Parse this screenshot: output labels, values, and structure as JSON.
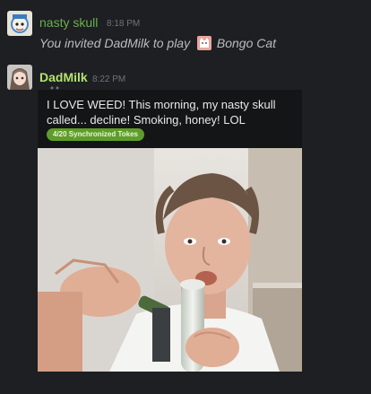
{
  "messages": [
    {
      "author": "nasty skull",
      "author_color": "#6ab04c",
      "time": "8:18 PM",
      "avatar_icon": "cartoon-character-avatar",
      "invite_text": "You invited DadMilk to play",
      "game_icon": "bongo-cat-game-icon",
      "game_name": "Bongo Cat"
    },
    {
      "author": "DadMilk",
      "author_color": "#b4e36b",
      "time": "8:22 PM",
      "avatar_icon": "anime-character-avatar",
      "card": {
        "text": "I LOVE WEED! This morning, my nasty skull called... decline! Smoking, honey! LOL",
        "tag": "4/20 Synchronized Tokes"
      },
      "image": "photo-of-man-with-bong"
    }
  ]
}
